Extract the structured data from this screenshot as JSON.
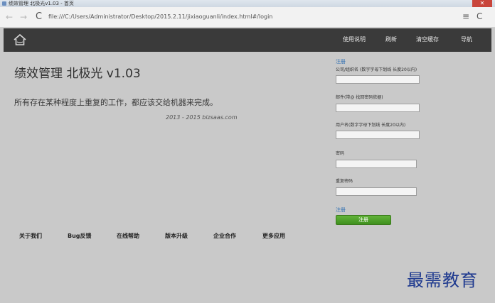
{
  "window": {
    "title": "绩效管理 北极光v1.03 - 首页",
    "close_glyph": "✕"
  },
  "browser": {
    "back_glyph": "←",
    "forward_glyph": "→",
    "reload_glyph": "C",
    "url": "file:///C:/Users/Administrator/Desktop/2015.2.11/jixiaoguanli/index.html#/login",
    "menu_glyph": "≡",
    "refresh_glyph": "C"
  },
  "navbar": {
    "home_icon": "home-icon",
    "links": [
      "使用说明",
      "刷新",
      "清空缓存",
      "导航"
    ]
  },
  "main": {
    "title": "绩效管理 北极光 v1.03",
    "slogan": "所有存在某种程度上重复的工作，都应该交给机器来完成。",
    "copyright": "2013 - 2015 bizsaas.com"
  },
  "footer": {
    "links": [
      "关于我们",
      "Bug反馈",
      "在线帮助",
      "版本升级",
      "企业合作",
      "更多应用"
    ]
  },
  "register": {
    "top_link": "注册",
    "fields": [
      {
        "label": "公司/组织名 (数字字母下划线 长度20以内)",
        "value": ""
      },
      {
        "label": "邮件(带@ 找回密码依据)",
        "value": ""
      },
      {
        "label": "用户名(数字字母下划线 长度20以内)",
        "value": ""
      },
      {
        "label": "密码",
        "value": ""
      },
      {
        "label": "重复密码",
        "value": ""
      }
    ],
    "bottom_link": "注册",
    "submit_label": "注册"
  },
  "watermark": "最需教育",
  "colors": {
    "navbar": "#3a3a3a",
    "page_bg": "#c9c9c9",
    "link": "#2f6fb2",
    "submit": "#4fa02a",
    "watermark": "#1f3a8f"
  }
}
